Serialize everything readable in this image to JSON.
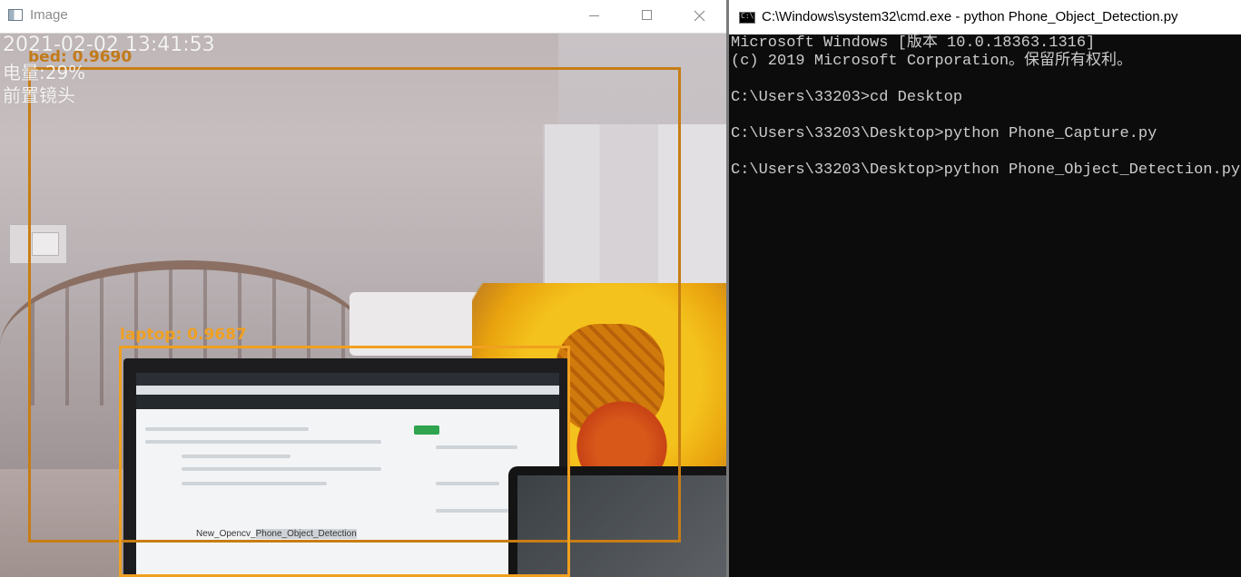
{
  "image_window": {
    "title": "Image",
    "overlay": {
      "timestamp": "2021-02-02 13:41:53",
      "battery": "电量:29%",
      "camera": "前置镜头"
    },
    "detections": [
      {
        "label": "bed: 0.9690",
        "color": "#c77d14"
      },
      {
        "label": "laptop: 0.9687",
        "color": "#f0a020"
      }
    ],
    "laptop_screen": {
      "repo_text_prefix": "New_Opencv_",
      "repo_text_highlight": "Phone_Object_Detection"
    }
  },
  "cmd_window": {
    "title": "C:\\Windows\\system32\\cmd.exe - python  Phone_Object_Detection.py",
    "lines": [
      "Microsoft Windows [版本 10.0.18363.1316]",
      "(c) 2019 Microsoft Corporation。保留所有权利。",
      "",
      "C:\\Users\\33203>cd Desktop",
      "",
      "C:\\Users\\33203\\Desktop>python Phone_Capture.py",
      "",
      "C:\\Users\\33203\\Desktop>python Phone_Object_Detection.py"
    ]
  }
}
